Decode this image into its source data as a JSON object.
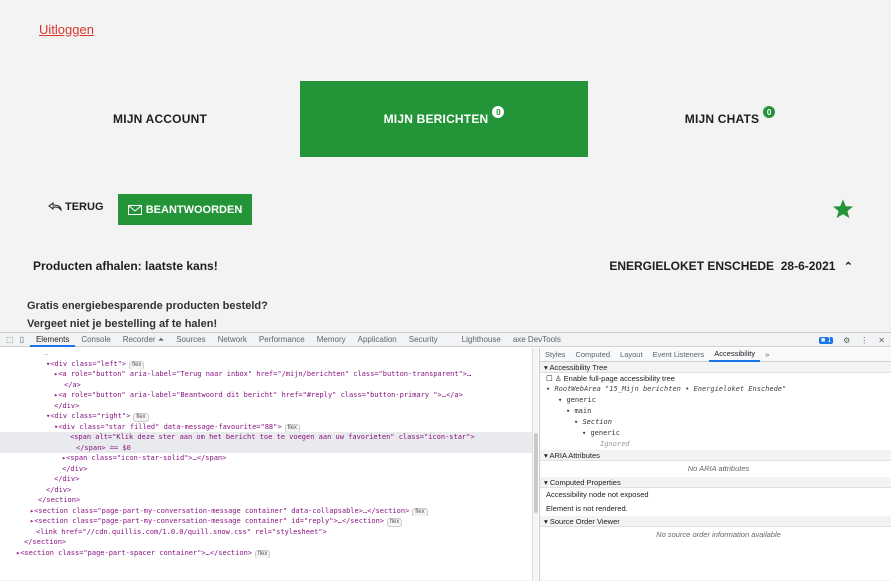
{
  "site": {
    "logout_label": "Uitloggen",
    "nav": [
      {
        "label": "MIJN ACCOUNT",
        "badge": ""
      },
      {
        "label": "MIJN BERICHTEN",
        "badge": "0"
      },
      {
        "label": "MIJN CHATS",
        "badge": "0"
      }
    ],
    "back_label": "TERUG",
    "reply_label": "BEANTWOORDEN",
    "subject": "Producten afhalen: laatste kans!",
    "sender": "ENERGIELOKET ENSCHEDE",
    "date": "28-6-2021",
    "body_line1": "Gratis energiebesparende producten besteld?",
    "body_line2": "Vergeet niet je bestelling af te halen!",
    "colors": {
      "brand_green": "#239438",
      "logout_red": "#d9362b"
    }
  },
  "devtools": {
    "tabs": [
      "Elements",
      "Console",
      "Recorder ⏶",
      "Sources",
      "Network",
      "Performance",
      "Memory",
      "Application",
      "Security",
      "Lighthouse",
      "axe DevTools"
    ],
    "issues_count": "1",
    "elements_lines": [
      "<div class=\"left\">",
      "<a role=\"button\" aria-label=\"Terug naar inbox\" href=\"/mijn/berichten\" class=\"button-transparent\">…",
      "</a>",
      "<a role=\"button\" aria-label=\"Beantwoord dit bericht\" href=\"#reply\" class=\"button-primary \">…</a>",
      "</div>",
      "<div class=\"right\">",
      "<div class=\"star filled\" data-message-favourite=\"88\">",
      "<span alt=\"Klik deze ster aan om het bericht toe te voegen aan uw favorieten\" class=\"icon-star\">",
      "</span> == $0",
      "<span class=\"icon-star-solid\">…</span>",
      "</div>",
      "</div>",
      "</div>",
      "</section>",
      "<section class=\"page-part-my-conversation-message container\" data-collapsable>…</section>",
      "<section class=\"page-part-my-conversation-message container\" id=\"reply\">…</section>",
      "<link href=\"//cdn.quillis.com/1.0.0/quill.snow.css\" rel=\"stylesheet\">",
      "</section>",
      "<section class=\"page-part-spacer container\">…</section>"
    ],
    "flex_badge": "flex",
    "pane_tabs": [
      "Styles",
      "Computed",
      "Layout",
      "Event Listeners",
      "Accessibility",
      "»"
    ],
    "accessibility_tree_header": "Accessibility Tree",
    "enable_tree_label": "Enable full-page accessibility tree",
    "root_label": "RootWebArea \"15_Mijn berichten • Energieloket Enschede\"",
    "tree": [
      "generic",
      "main",
      "Section",
      "generic",
      "Ignored"
    ],
    "aria_header": "ARIA Attributes",
    "aria_empty": "No ARIA attributes",
    "computed_header": "Computed Properties",
    "computed_line1": "Accessibility node not exposed",
    "computed_line2": "Element is not rendered.",
    "source_order_header": "Source Order Viewer",
    "source_order_empty": "No source order information available"
  }
}
